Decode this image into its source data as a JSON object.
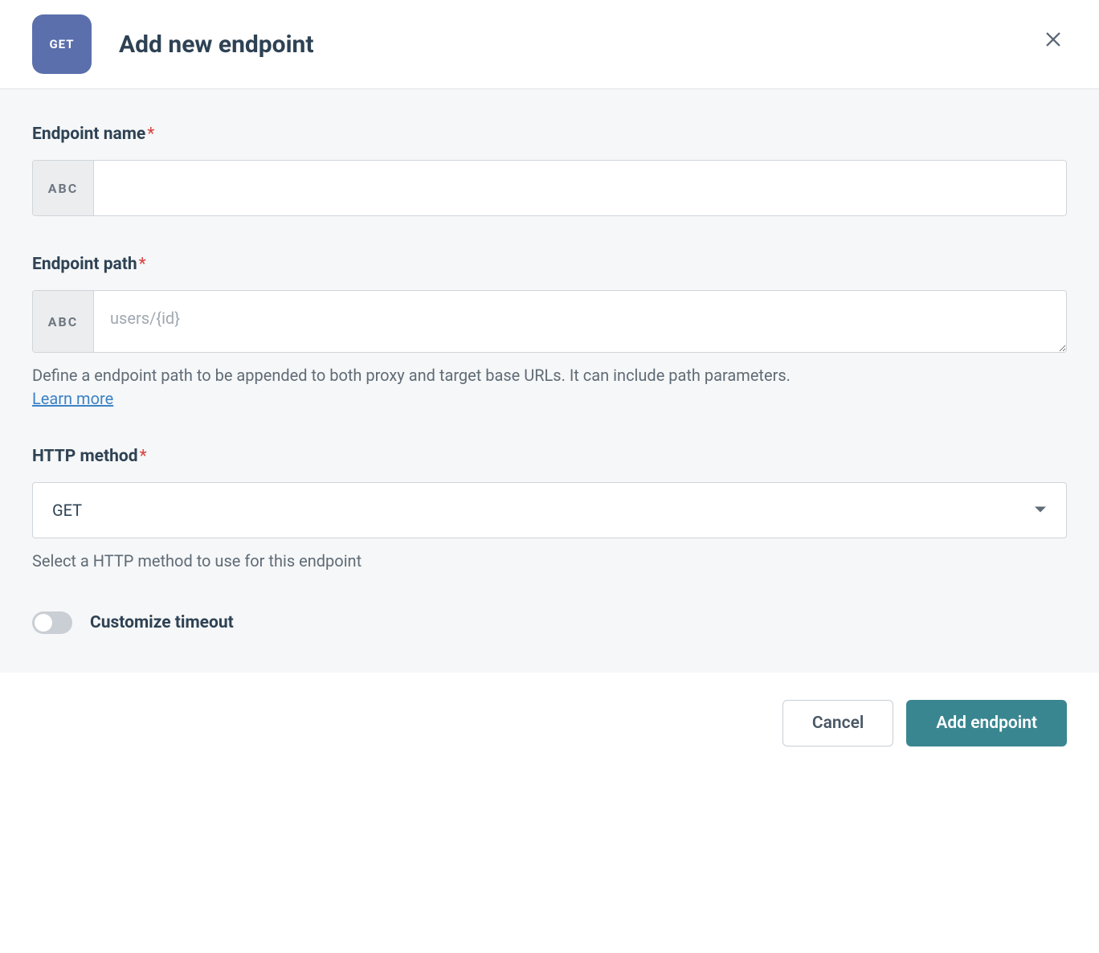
{
  "header": {
    "method_badge": "GET",
    "title": "Add new endpoint"
  },
  "form": {
    "endpoint_name": {
      "label": "Endpoint name",
      "required_marker": "*",
      "prefix": "ABC",
      "value": ""
    },
    "endpoint_path": {
      "label": "Endpoint path",
      "required_marker": "*",
      "prefix": "ABC",
      "placeholder": "users/{id}",
      "value": "",
      "help": "Define a endpoint path to be appended to both proxy and target base URLs. It can include path parameters.",
      "learn_more": "Learn more"
    },
    "http_method": {
      "label": "HTTP method",
      "required_marker": "*",
      "selected": "GET",
      "help": "Select a HTTP method to use for this endpoint"
    },
    "customize_timeout": {
      "label": "Customize timeout",
      "enabled": false
    }
  },
  "footer": {
    "cancel": "Cancel",
    "submit": "Add endpoint"
  }
}
